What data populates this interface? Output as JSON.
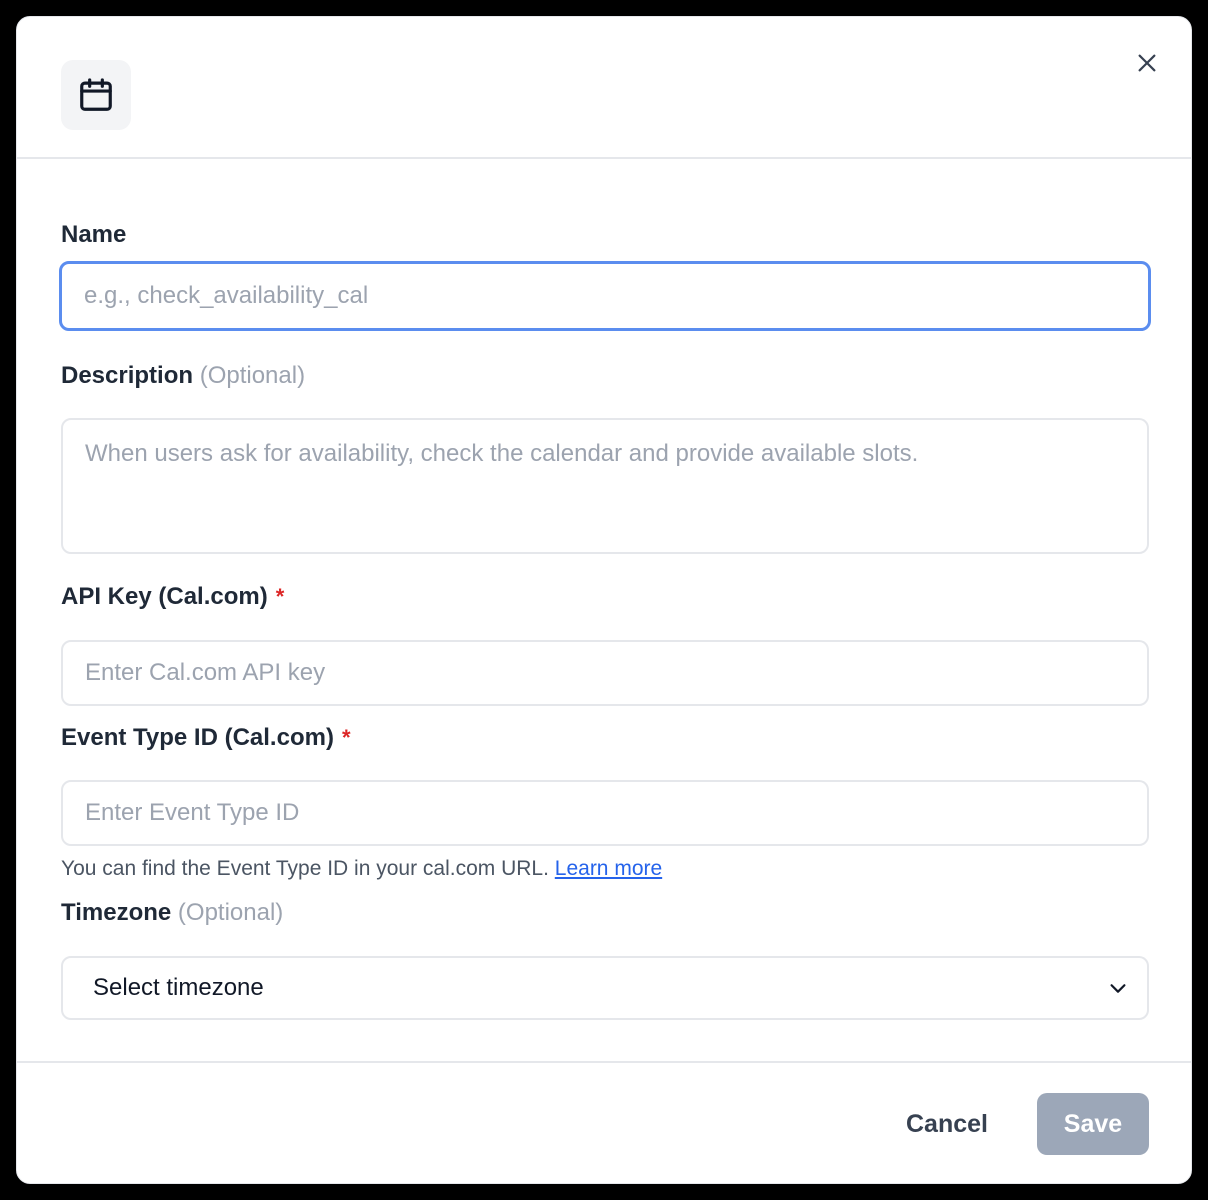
{
  "dialog": {
    "header_icon": "calendar-icon",
    "close_icon": "close-icon"
  },
  "form": {
    "name": {
      "label": "Name",
      "placeholder": "e.g., check_availability_cal",
      "value": ""
    },
    "description": {
      "label": "Description",
      "optional": "(Optional)",
      "placeholder": "When users ask for availability, check the calendar and provide available slots.",
      "value": ""
    },
    "api_key": {
      "label": "API Key (Cal.com)",
      "required": "*",
      "placeholder": "Enter Cal.com API key",
      "value": ""
    },
    "event_type_id": {
      "label": "Event Type ID (Cal.com)",
      "required": "*",
      "placeholder": "Enter Event Type ID",
      "value": "",
      "help": "You can find the Event Type ID in your cal.com URL.",
      "help_link": "Learn more"
    },
    "timezone": {
      "label": "Timezone",
      "optional": "(Optional)",
      "selected": "Select timezone",
      "chevron_icon": "chevron-down-icon"
    }
  },
  "footer": {
    "cancel_label": "Cancel",
    "save_label": "Save"
  },
  "colors": {
    "focus_ring": "#5b8def",
    "required": "#dc2626",
    "link": "#2563eb",
    "save_disabled": "#9ca7b8"
  }
}
